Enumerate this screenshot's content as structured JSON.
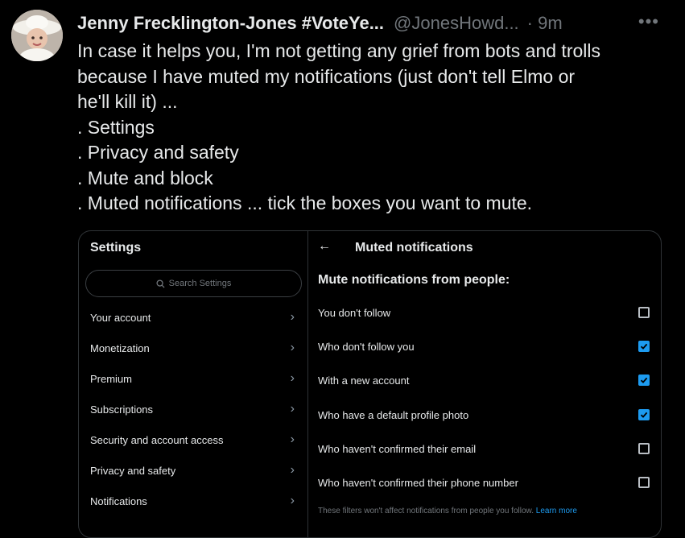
{
  "tweet": {
    "author": "Jenny Frecklington-Jones #VoteYe...",
    "handle": "@JonesHowd...",
    "time": "· 9m",
    "more": "•••",
    "lines": [
      "In case it helps you, I'm not getting any grief from bots and trolls",
      "because I have muted my notifications (just don't tell Elmo or",
      "he'll kill it) ...",
      ". Settings",
      ". Privacy and safety",
      ". Mute and block",
      ". Muted notifications ... tick the boxes you want to mute."
    ]
  },
  "settings": {
    "title": "Settings",
    "search_placeholder": "Search Settings",
    "items": [
      {
        "label": "Your account"
      },
      {
        "label": "Monetization"
      },
      {
        "label": "Premium"
      },
      {
        "label": "Subscriptions"
      },
      {
        "label": "Security and account access"
      },
      {
        "label": "Privacy and safety"
      },
      {
        "label": "Notifications"
      }
    ]
  },
  "muted": {
    "back": "←",
    "title": "Muted notifications",
    "section_title": "Mute notifications from people:",
    "options": [
      {
        "label": "You don't follow",
        "checked": false
      },
      {
        "label": "Who don't follow you",
        "checked": true
      },
      {
        "label": "With a new account",
        "checked": true
      },
      {
        "label": "Who have a default profile photo",
        "checked": true
      },
      {
        "label": "Who haven't confirmed their email",
        "checked": false
      },
      {
        "label": "Who haven't confirmed their phone number",
        "checked": false
      }
    ],
    "footer_text": "These filters won't affect notifications from people you follow.",
    "footer_link": "Learn more"
  },
  "colors": {
    "accent": "#1d9bf0",
    "muted_text": "#71767b",
    "text": "#e7e9ea",
    "border": "#2f3336"
  },
  "icons": [
    "avatar",
    "more-icon",
    "search-icon",
    "chevron-right-icon",
    "back-arrow-icon",
    "checkbox-icon"
  ]
}
